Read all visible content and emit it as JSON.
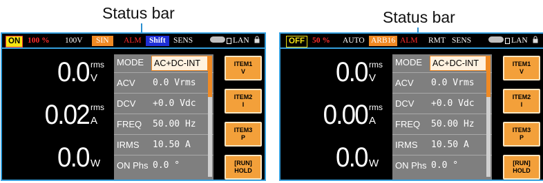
{
  "callouts": [
    "Status bar",
    "Status bar"
  ],
  "panels": [
    {
      "status": {
        "output": "ON",
        "percent": "100 %",
        "voltage_range": "100V",
        "waveform": "SIN",
        "alm": "ALM",
        "shift": "Shift",
        "sens": "SENS",
        "lan": "LAN"
      },
      "readings": [
        {
          "value": "0.0",
          "sup": "rms",
          "sub": "V"
        },
        {
          "value": "0.02",
          "sup": "rms",
          "sub": "A"
        },
        {
          "value": "0.0",
          "sup": "",
          "sub": "W"
        }
      ],
      "params": [
        {
          "key": "MODE",
          "value": "AC+DC-INT"
        },
        {
          "key": "ACV",
          "value": "0.0 Vrms"
        },
        {
          "key": "DCV",
          "value": "+0.0 Vdc"
        },
        {
          "key": "FREQ",
          "value": "50.00 Hz"
        },
        {
          "key": "IRMS",
          "value": "10.50 A"
        },
        {
          "key": "ON Phs",
          "value": "0.0 °"
        }
      ],
      "buttons": [
        {
          "line1": "ITEM1",
          "line2": "V"
        },
        {
          "line1": "ITEM2",
          "line2": "I"
        },
        {
          "line1": "ITEM3",
          "line2": "P"
        },
        {
          "line1": "[RUN]",
          "line2": "HOLD"
        }
      ]
    },
    {
      "status": {
        "output": "OFF",
        "percent": "50 %",
        "mode": "AUTO",
        "waveform": "ARB16",
        "alm": "ALM",
        "rmt": "RMT",
        "sens": "SENS",
        "lan": "LAN"
      },
      "readings": [
        {
          "value": "0.0",
          "sup": "rms",
          "sub": "V"
        },
        {
          "value": "0.00",
          "sup": "rms",
          "sub": "A"
        },
        {
          "value": "0.0",
          "sup": "",
          "sub": "W"
        }
      ],
      "params": [
        {
          "key": "MODE",
          "value": "AC+DC-INT"
        },
        {
          "key": "ACV",
          "value": "0.0 Vrms"
        },
        {
          "key": "DCV",
          "value": "+0.0 Vdc"
        },
        {
          "key": "FREQ",
          "value": "50.00 Hz"
        },
        {
          "key": "IRMS",
          "value": "10.50 A"
        },
        {
          "key": "ON Phs",
          "value": "0.0 °"
        }
      ],
      "buttons": [
        {
          "line1": "ITEM1",
          "line2": "V"
        },
        {
          "line1": "ITEM2",
          "line2": "I"
        },
        {
          "line1": "ITEM3",
          "line2": "P"
        },
        {
          "line1": "[RUN]",
          "line2": "HOLD"
        }
      ]
    }
  ],
  "colors": {
    "frame": "#35a0df",
    "accent": "#f08a24",
    "on_badge": "#f6e512",
    "alarm": "#ff2a2a",
    "shift": "#1f2fd6"
  }
}
